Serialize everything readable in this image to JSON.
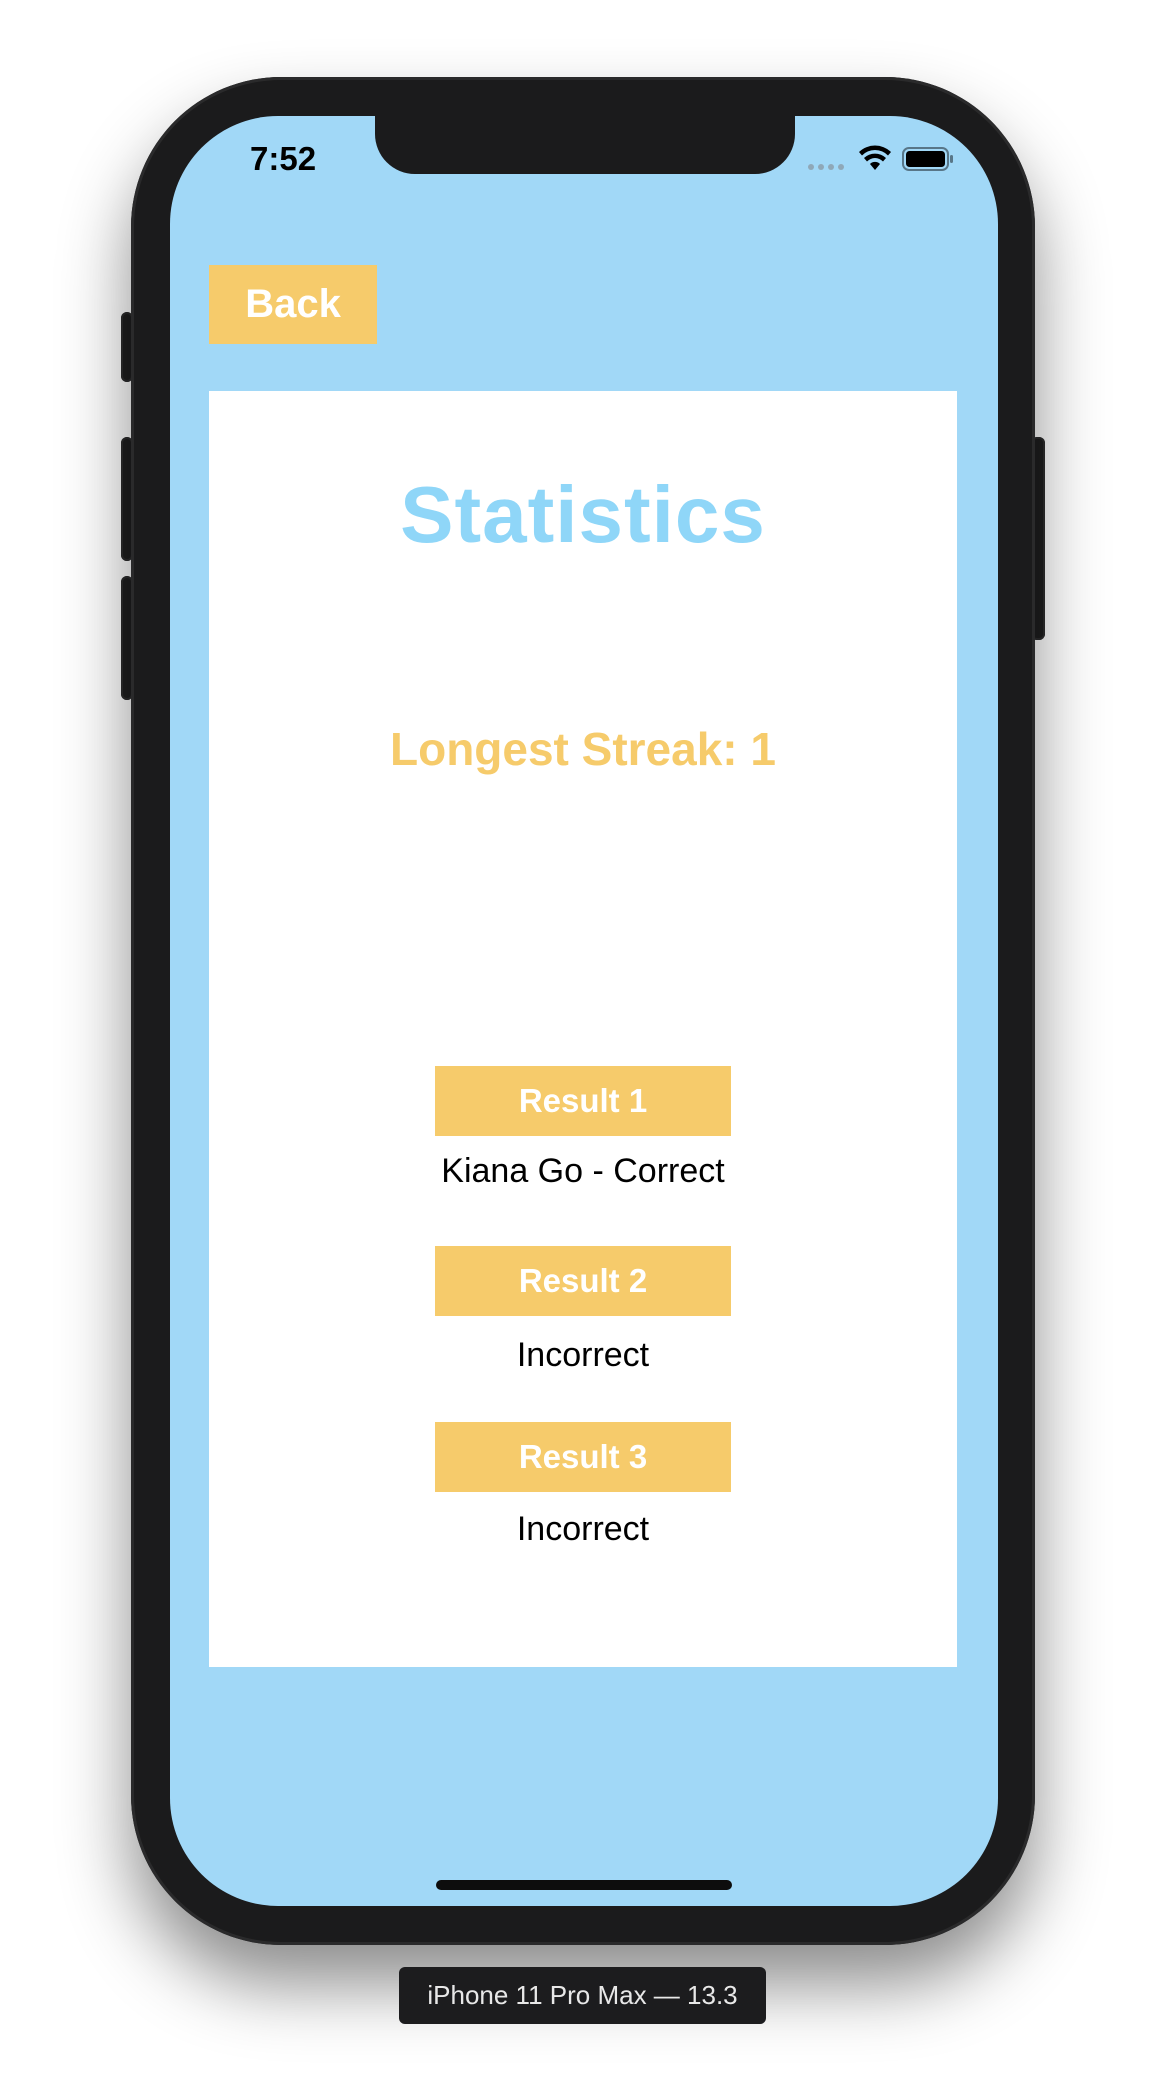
{
  "status_bar": {
    "time": "7:52",
    "icons": [
      "signal-dots-icon",
      "wifi-icon",
      "battery-icon"
    ]
  },
  "toolbar": {
    "back_label": "Back"
  },
  "main": {
    "title": "Statistics",
    "streak": "Longest Streak: 1",
    "results": [
      {
        "label": "Result 1",
        "value": "Kiana Go - Correct"
      },
      {
        "label": "Result 2",
        "value": "Incorrect"
      },
      {
        "label": "Result 3",
        "value": "Incorrect"
      }
    ]
  },
  "device": {
    "label": "iPhone 11 Pro Max — 13.3"
  },
  "colors": {
    "screen_background": "#a1d8f7",
    "accent_yellow": "#f6cb6b",
    "title_blue": "#8fd6f8",
    "card_background": "#ffffff",
    "phone_frame": "#1b1b1c"
  }
}
